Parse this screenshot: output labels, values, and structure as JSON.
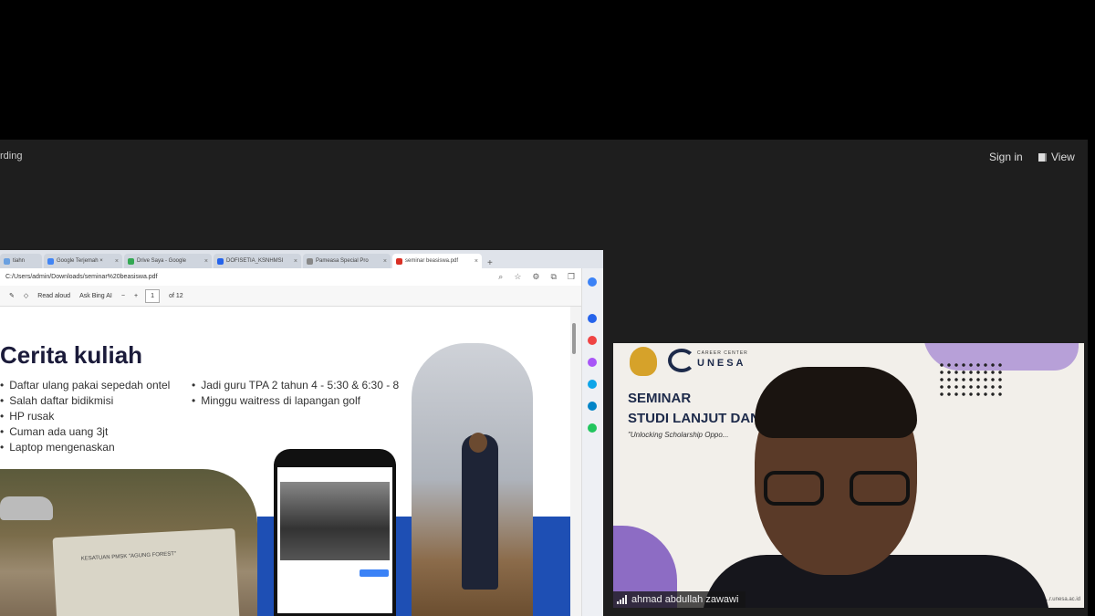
{
  "meeting": {
    "recording_text": "rding",
    "sign_in_label": "Sign in",
    "view_label": "View",
    "participant_name": "ahmad abdullah zawawi"
  },
  "browser": {
    "tabs": [
      {
        "label": "tiahn",
        "icon_color": "#6aa0e0"
      },
      {
        "label": "Google Terjemah ×",
        "icon_color": "#4285f4"
      },
      {
        "label": "Drive Saya - Google",
        "icon_color": "#34a853"
      },
      {
        "label": "DOFISETIA_KSNHMSI",
        "icon_color": "#2563eb"
      },
      {
        "label": "Pameasa Special Pro",
        "icon_color": "#888888"
      },
      {
        "label": "seminar beasiswa.pdf",
        "icon_color": "#d93025",
        "active": true
      }
    ],
    "url": "C:/Users/admin/Downloads/seminar%20beasiswa.pdf",
    "pdf_toolbar": {
      "read_aloud": "Read aloud",
      "ask_bing": "Ask Bing AI",
      "page_current": "1",
      "page_total": "of 12"
    }
  },
  "slide": {
    "title": "Cerita kuliah",
    "bullets_left": [
      "Daftar ulang pakai sepedah ontel",
      "Salah daftar bidikmisi",
      "HP rusak",
      "Cuman ada uang 3jt",
      "Laptop mengenaskan"
    ],
    "bullets_right": [
      "Jadi guru TPA 2 tahun 4 - 5:30 & 6:30 - 8",
      "Minggu waitress di lapangan golf"
    ],
    "sign_text": "KESATUAN PMSK \"AGUNG FOREST\""
  },
  "video_banner": {
    "logo_small": "CAREER CENTER",
    "logo": "UNESA",
    "seminar": "SEMINAR",
    "studi": "STUDI LANJUT DAN ... MAHASISWA 2023",
    "tagline": "\"Unlocking Scholarship Oppo...",
    "footer": "...r.unesa.ac.id"
  },
  "colors": {
    "slide_blue": "#1e4fb4",
    "banner_navy": "#1d2a4a",
    "banner_purple": "#b7a0d8"
  }
}
